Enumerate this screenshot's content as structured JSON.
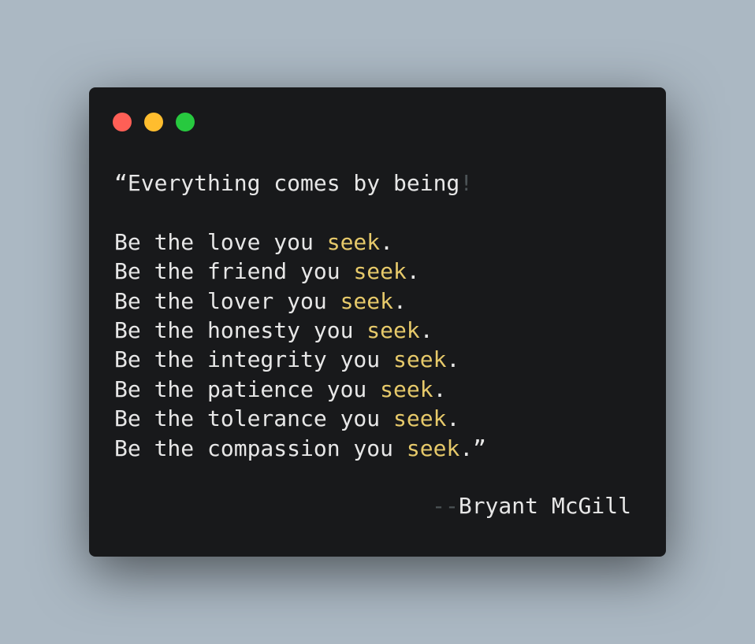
{
  "window": {
    "controls": [
      {
        "name": "close",
        "color": "#ff5f56"
      },
      {
        "name": "minimize",
        "color": "#ffbd2e"
      },
      {
        "name": "zoom",
        "color": "#27c93f"
      }
    ]
  },
  "quote": {
    "opening": "“Everything comes by being",
    "opening_punct": "!",
    "lines": [
      {
        "prefix": "Be the love you ",
        "keyword": "seek",
        "suffix": "."
      },
      {
        "prefix": "Be the friend you ",
        "keyword": "seek",
        "suffix": "."
      },
      {
        "prefix": "Be the lover you ",
        "keyword": "seek",
        "suffix": "."
      },
      {
        "prefix": "Be the honesty you ",
        "keyword": "seek",
        "suffix": "."
      },
      {
        "prefix": "Be the integrity you ",
        "keyword": "seek",
        "suffix": "."
      },
      {
        "prefix": "Be the patience you ",
        "keyword": "seek",
        "suffix": "."
      },
      {
        "prefix": "Be the tolerance you ",
        "keyword": "seek",
        "suffix": "."
      },
      {
        "prefix": "Be the compassion you ",
        "keyword": "seek",
        "suffix": ".”"
      }
    ]
  },
  "attribution": {
    "dashes": "--",
    "author": "Bryant McGill"
  },
  "colors": {
    "background": "#abb8c3",
    "window": "#18191b",
    "text": "#e7e7e7",
    "keyword": "#e6c96a",
    "muted": "#4c5356"
  }
}
